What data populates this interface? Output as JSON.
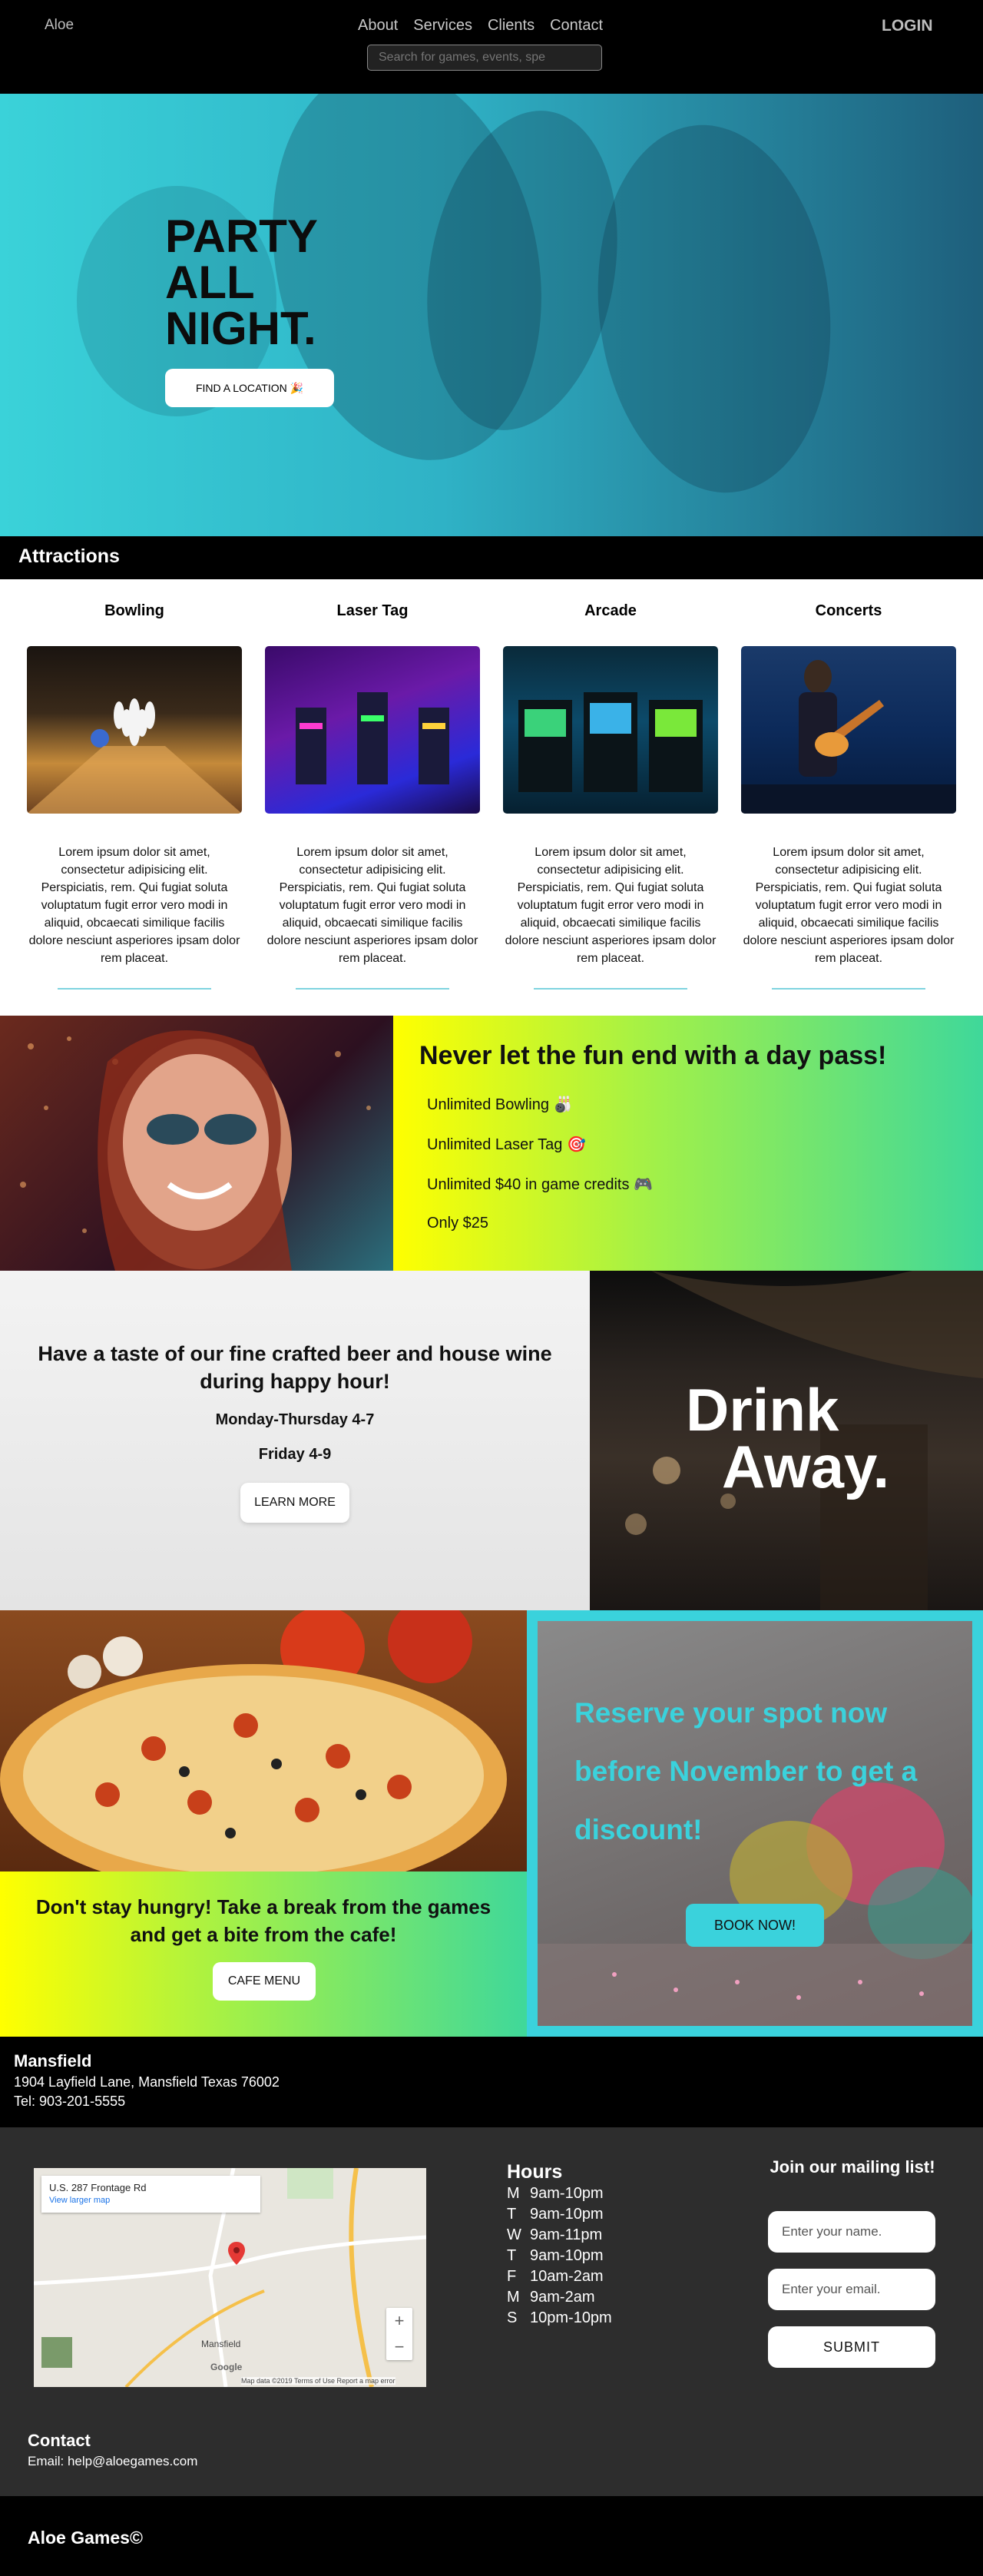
{
  "nav": {
    "brand": "Aloe",
    "links": [
      "About",
      "Services",
      "Clients",
      "Contact"
    ],
    "search_placeholder": "Search for games, events, spe",
    "login": "LOGIN"
  },
  "hero": {
    "title_lines": [
      "PARTY",
      "ALL",
      "NIGHT."
    ],
    "button": "FIND A LOCATION 🎉"
  },
  "attractions": {
    "title": "Attractions",
    "items": [
      {
        "name": "Bowling",
        "text": "Lorem ipsum dolor sit amet, consectetur adipisicing elit. Perspiciatis, rem. Qui fugiat soluta voluptatum fugit error vero modi in aliquid, obcaecati similique facilis dolore nesciunt asperiores ipsam dolor rem placeat."
      },
      {
        "name": "Laser Tag",
        "text": "Lorem ipsum dolor sit amet, consectetur adipisicing elit. Perspiciatis, rem. Qui fugiat soluta voluptatum fugit error vero modi in aliquid, obcaecati similique facilis dolore nesciunt asperiores ipsam dolor rem placeat."
      },
      {
        "name": "Arcade",
        "text": "Lorem ipsum dolor sit amet, consectetur adipisicing elit. Perspiciatis, rem. Qui fugiat soluta voluptatum fugit error vero modi in aliquid, obcaecati similique facilis dolore nesciunt asperiores ipsam dolor rem placeat."
      },
      {
        "name": "Concerts",
        "text": "Lorem ipsum dolor sit amet, consectetur adipisicing elit. Perspiciatis, rem. Qui fugiat soluta voluptatum fugit error vero modi in aliquid, obcaecati similique facilis dolore nesciunt asperiores ipsam dolor rem placeat."
      }
    ]
  },
  "daypass": {
    "title": "Never let the fun end with a day pass!",
    "items": [
      "Unlimited Bowling 🎳",
      "Unlimited Laser Tag 🎯",
      "Unlimited $40 in game credits 🎮",
      "Only $25"
    ]
  },
  "happy_hour": {
    "title": "Have a taste of our fine crafted beer and house wine during happy hour!",
    "line1": "Monday-Thursday 4-7",
    "line2": "Friday 4-9",
    "button": "LEARN MORE",
    "drink1": "Drink",
    "drink2": "Away."
  },
  "cafe": {
    "title": "Don't stay hungry! Take a break from the games and get a bite from the cafe!",
    "button": "CAFE MENU"
  },
  "reserve": {
    "title": "Reserve your spot now before November to get a discount!",
    "button": "BOOK NOW!"
  },
  "location": {
    "name": "Mansfield",
    "address": "1904 Layfield Lane, Mansfield Texas 76002",
    "phone": "Tel: 903-201-5555"
  },
  "map": {
    "card_title": "U.S. 287 Frontage Rd",
    "card_link": "View larger map",
    "city_label": "Mansfield",
    "attribution": "Map data ©2019   Terms of Use   Report a map error",
    "logo": "Google"
  },
  "hours": {
    "title": "Hours",
    "rows": [
      {
        "day": "M",
        "time": "9am-10pm"
      },
      {
        "day": "T",
        "time": "9am-10pm"
      },
      {
        "day": "W",
        "time": "9am-11pm"
      },
      {
        "day": "T",
        "time": "9am-10pm"
      },
      {
        "day": "F",
        "time": "10am-2am"
      },
      {
        "day": "M",
        "time": "9am-2am"
      },
      {
        "day": "S",
        "time": "10pm-10pm"
      }
    ]
  },
  "mailing": {
    "title": "Join our mailing list!",
    "name_placeholder": "Enter your name.",
    "email_placeholder": "Enter your email.",
    "submit": "SUBMIT"
  },
  "contact": {
    "title": "Contact",
    "email": "Email: help@aloegames.com"
  },
  "copyright": "Aloe Games©",
  "colors": {
    "accent": "#3ad2dc",
    "gradient_start": "#ffff00",
    "gradient_end": "#3fd89a"
  }
}
